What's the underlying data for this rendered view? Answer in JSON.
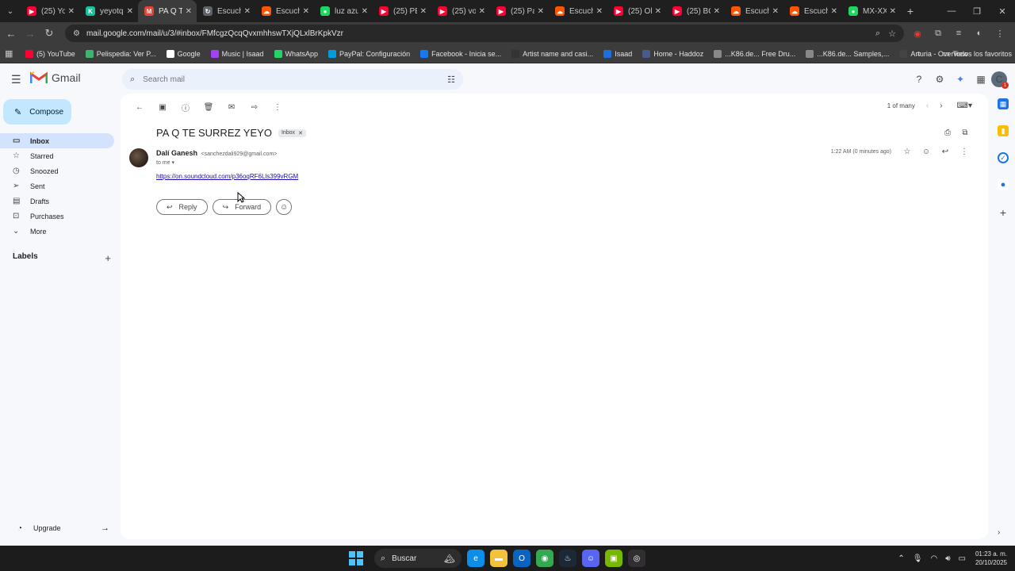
{
  "browser": {
    "tabs": [
      {
        "title": "(25) Yo",
        "color": "#ff0033",
        "glyph": "▶"
      },
      {
        "title": "yeyotq",
        "color": "#15c39a",
        "glyph": "K"
      },
      {
        "title": "PA Q TE",
        "color": "#ea4335",
        "glyph": "M",
        "active": true
      },
      {
        "title": "Escuch",
        "color": "#5f6368",
        "glyph": "↻"
      },
      {
        "title": "Escuch",
        "color": "#ff5500",
        "glyph": "☁"
      },
      {
        "title": "luz azu",
        "color": "#1ed760",
        "glyph": "●"
      },
      {
        "title": "(25) PE",
        "color": "#ff0033",
        "glyph": "▶"
      },
      {
        "title": "(25) vo",
        "color": "#ff0033",
        "glyph": "▶"
      },
      {
        "title": "(25) Pa",
        "color": "#ff0033",
        "glyph": "▶"
      },
      {
        "title": "Escuch",
        "color": "#ff5500",
        "glyph": "☁"
      },
      {
        "title": "(25) Ol",
        "color": "#ff0033",
        "glyph": "▶"
      },
      {
        "title": "(25) BO",
        "color": "#ff0033",
        "glyph": "▶"
      },
      {
        "title": "Escuch",
        "color": "#ff5500",
        "glyph": "☁"
      },
      {
        "title": "Escuch",
        "color": "#ff5500",
        "glyph": "☁"
      },
      {
        "title": "MX-XX",
        "color": "#1ed760",
        "glyph": "●"
      }
    ],
    "url": "mail.google.com/mail/u/3/#inbox/FMfcgzQcqQvxmhhswTXjQLxlBrKpkVzr",
    "bookmarks": [
      {
        "label": "(5) YouTube",
        "color": "#ff0033"
      },
      {
        "label": "Pelispedia: Ver P...",
        "color": "#3cb371"
      },
      {
        "label": "Google",
        "color": "#ffffff"
      },
      {
        "label": "Music | Isaad",
        "color": "#a142f4"
      },
      {
        "label": "WhatsApp",
        "color": "#25d366"
      },
      {
        "label": "PayPal: Configuración",
        "color": "#009cde"
      },
      {
        "label": "Facebook - Inicia se...",
        "color": "#1877f2"
      },
      {
        "label": "Artist name and casi...",
        "color": "#333333"
      },
      {
        "label": "Isaad",
        "color": "#1e6fd9"
      },
      {
        "label": "Home - Haddoz",
        "color": "#4a5a8a"
      },
      {
        "label": "...K86.de... Free Dru...",
        "color": "#888888"
      },
      {
        "label": "...K86.de... Samples,...",
        "color": "#888888"
      },
      {
        "label": "Arturia - Overview",
        "color": "#444444"
      }
    ],
    "all_bookmarks_label": "Todos los favoritos"
  },
  "gmail": {
    "logo_text": "Gmail",
    "search_placeholder": "Search mail",
    "avatar_letter": "C",
    "avatar_badge": "1",
    "compose_label": "Compose",
    "nav": [
      {
        "label": "Inbox",
        "icon": "▭",
        "active": true
      },
      {
        "label": "Starred",
        "icon": "☆"
      },
      {
        "label": "Snoozed",
        "icon": "◷"
      },
      {
        "label": "Sent",
        "icon": "➢"
      },
      {
        "label": "Drafts",
        "icon": "▤"
      },
      {
        "label": "Purchases",
        "icon": "⊡"
      },
      {
        "label": "More",
        "icon": "⌄"
      }
    ],
    "labels_heading": "Labels",
    "upgrade_label": "Upgrade",
    "pager_text": "1 of many",
    "subject": "PA Q TE SURREZ YEYO",
    "inbox_chip": "Inbox",
    "sender_name": "Dalí Ganesh",
    "sender_email": "<sanchezdali929@gmail.com>",
    "to_line": "to me",
    "time": "1:22 AM (0 minutes ago)",
    "body_link": "https://on.soundcloud.com/p36oqRF6Lls399vRGM",
    "reply_label": "Reply",
    "forward_label": "Forward"
  },
  "taskbar": {
    "search_label": "Buscar",
    "time": "01:23 a. m.",
    "date": "20/10/2025",
    "apps": [
      {
        "name": "edge-icon",
        "color": "#0c8de8",
        "glyph": "e"
      },
      {
        "name": "file-explorer-icon",
        "color": "#f3c13a",
        "glyph": "▬"
      },
      {
        "name": "outlook-icon",
        "color": "#0a64c2",
        "glyph": "O"
      },
      {
        "name": "chrome-icon",
        "color": "#34a853",
        "glyph": "◉"
      },
      {
        "name": "steam-icon",
        "color": "#1b2838",
        "glyph": "♨"
      },
      {
        "name": "discord-icon",
        "color": "#5865f2",
        "glyph": "☺"
      },
      {
        "name": "nvidia-icon",
        "color": "#76b900",
        "glyph": "▣"
      },
      {
        "name": "obs-icon",
        "color": "#302e31",
        "glyph": "◎"
      }
    ]
  }
}
